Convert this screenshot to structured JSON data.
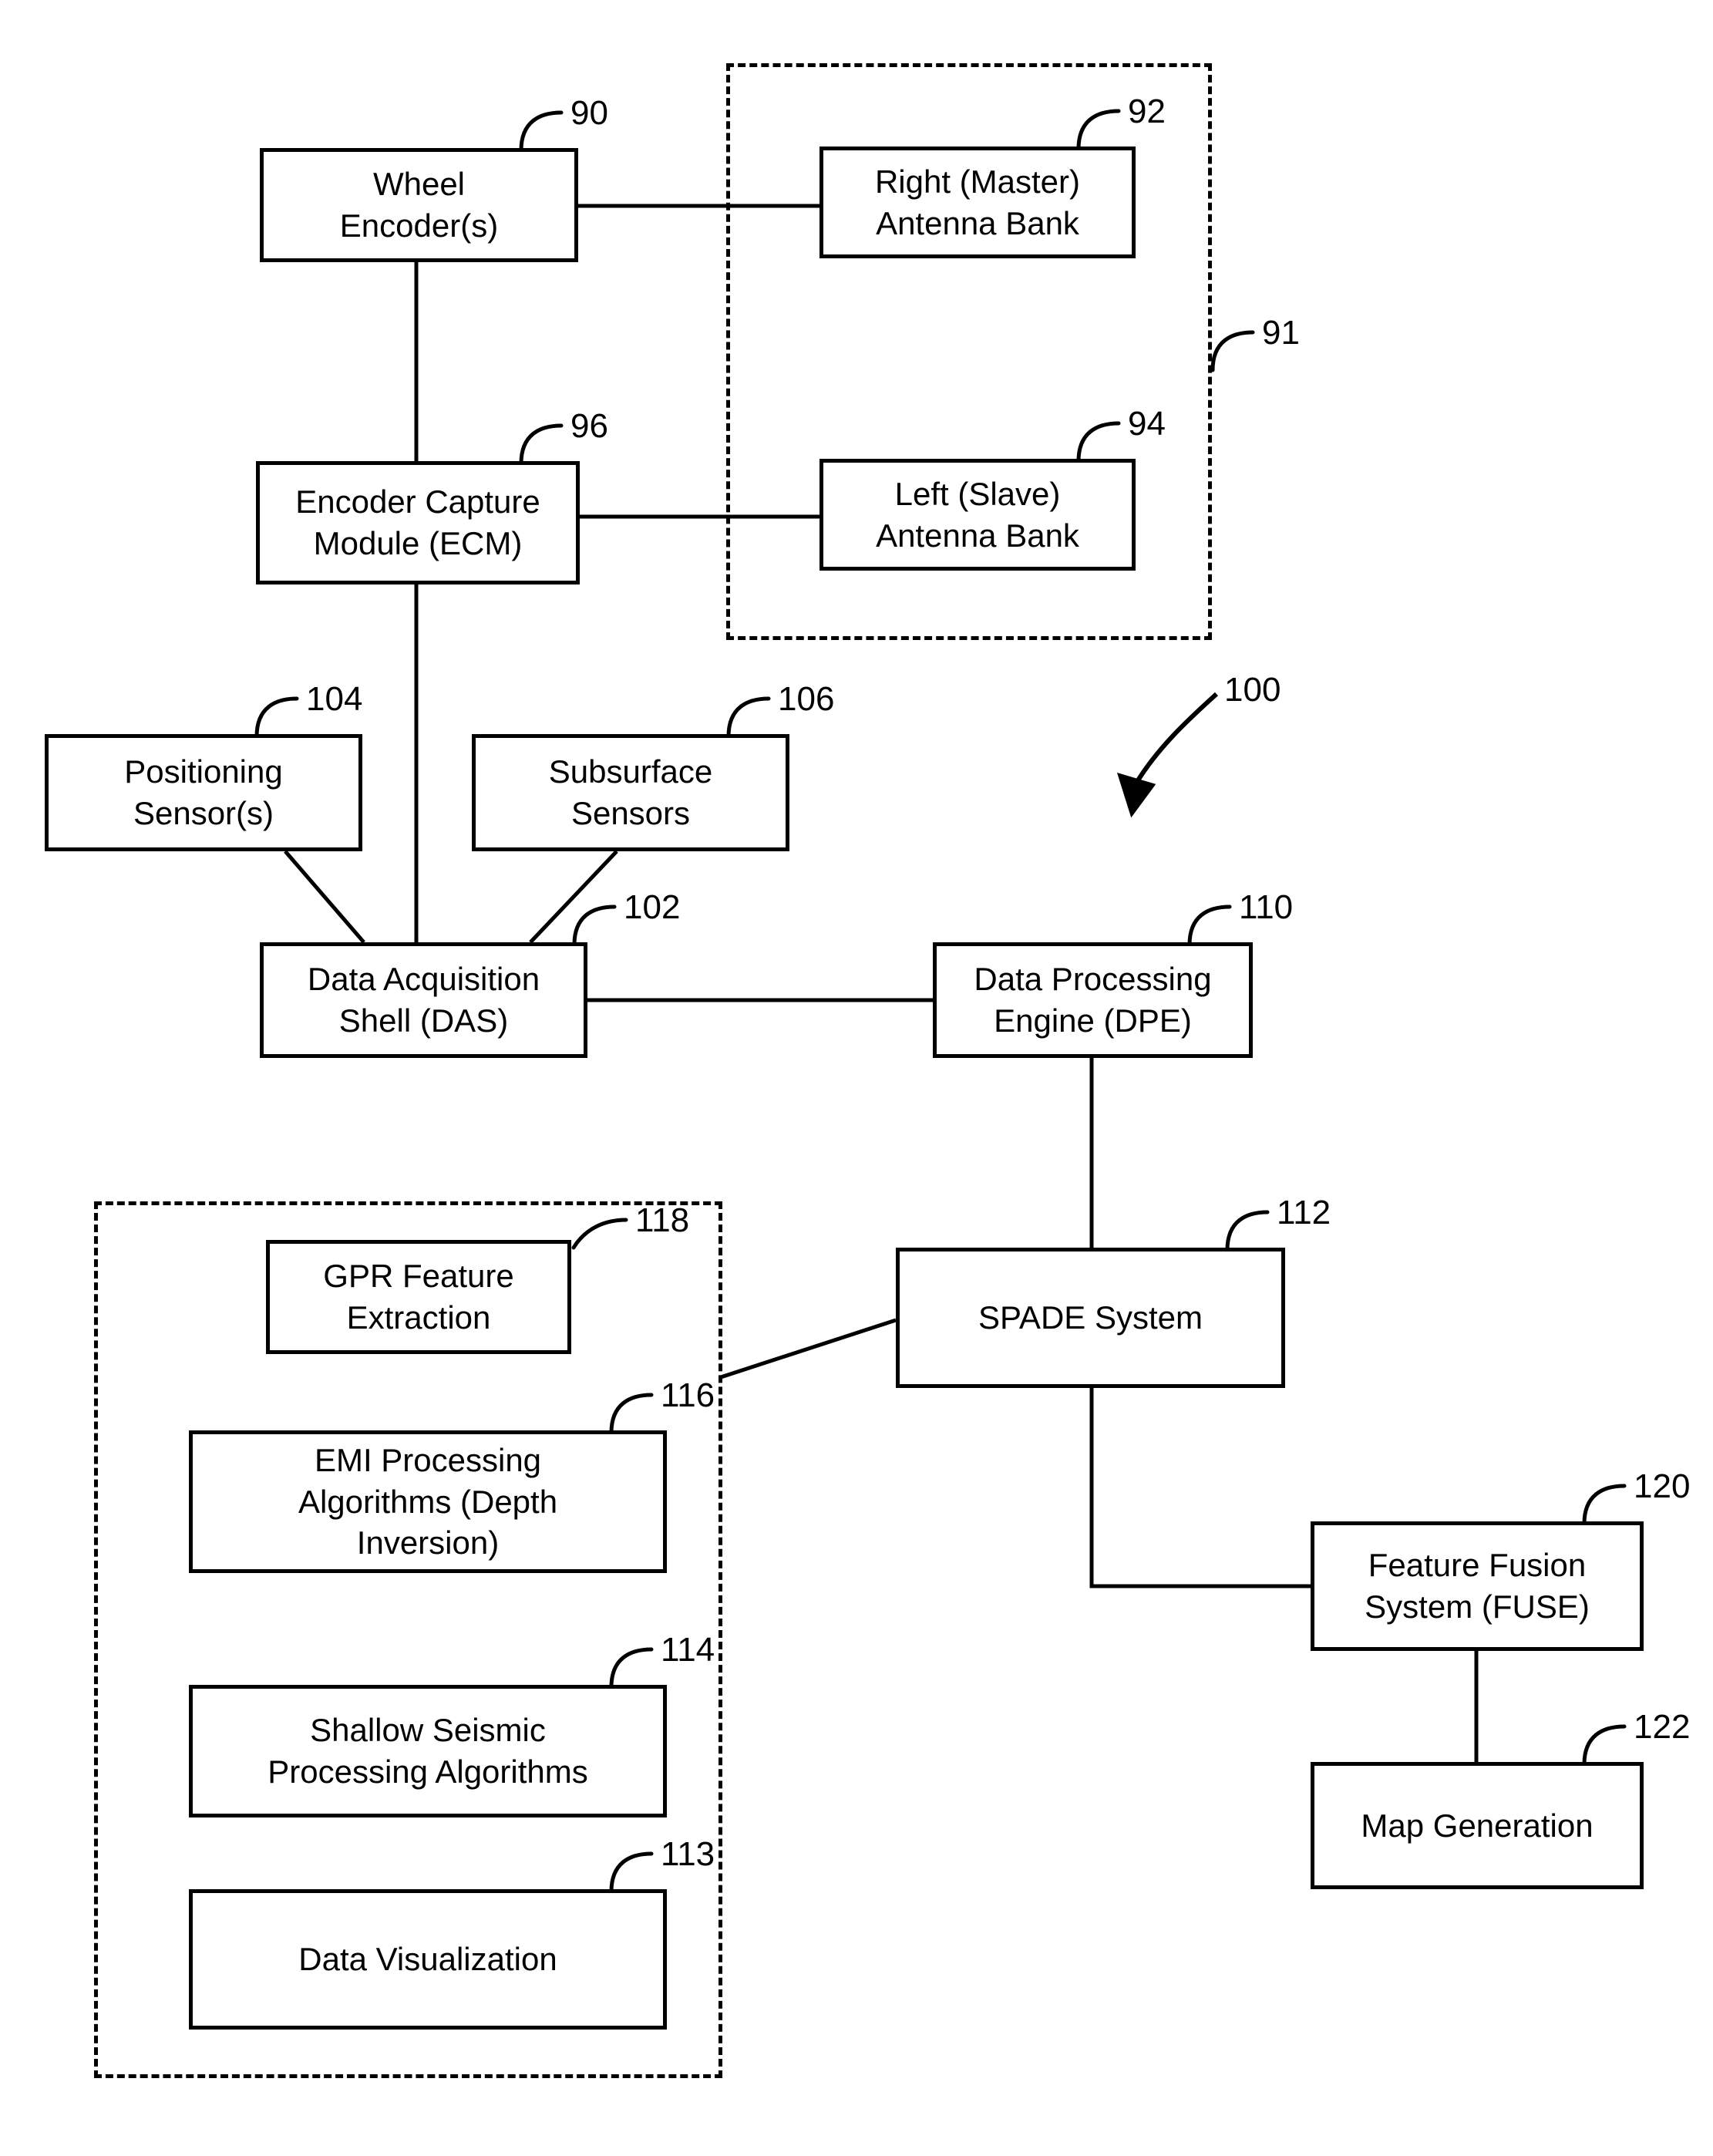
{
  "figure": {
    "type": "patent-block-diagram",
    "system_ref": "100",
    "background": "#ffffff",
    "line_color": "#000000"
  },
  "groups": [
    {
      "id": "antenna-group",
      "ref": "91",
      "style": "dashed"
    },
    {
      "id": "algorithms-group",
      "ref": "",
      "style": "dashed"
    }
  ],
  "nodes": {
    "wheel_encoder": {
      "line1": "Wheel",
      "line2": "Encoder(s)",
      "ref": "90"
    },
    "right_antenna_bank": {
      "line1": "Right (Master)",
      "line2": "Antenna Bank",
      "ref": "92"
    },
    "encoder_capture_module": {
      "line1": "Encoder Capture",
      "line2": "Module (ECM)",
      "ref": "96"
    },
    "left_antenna_bank": {
      "line1": "Left (Slave)",
      "line2": "Antenna Bank",
      "ref": "94"
    },
    "positioning_sensors": {
      "line1": "Positioning",
      "line2": "Sensor(s)",
      "ref": "104"
    },
    "subsurface_sensors": {
      "line1": "Subsurface",
      "line2": "Sensors",
      "ref": "106"
    },
    "data_acquisition_shell": {
      "line1": "Data Acquisition",
      "line2": "Shell (DAS)",
      "ref": "102"
    },
    "data_processing_engine": {
      "line1": "Data Processing",
      "line2": "Engine (DPE)",
      "ref": "110"
    },
    "spade_system": {
      "line1": "SPADE System",
      "line2": "",
      "ref": "112"
    },
    "gpr_feature_extraction": {
      "line1": "GPR Feature",
      "line2": "Extraction",
      "ref": "118"
    },
    "emi_processing": {
      "line1": "EMI Processing",
      "line2": "Algorithms (Depth",
      "line3": "Inversion)",
      "ref": "116"
    },
    "shallow_seismic": {
      "line1": "Shallow Seismic",
      "line2": "Processing Algorithms",
      "ref": "114"
    },
    "data_visualization": {
      "line1": "Data Visualization",
      "line2": "",
      "ref": "113"
    },
    "feature_fusion_system": {
      "line1": "Feature Fusion",
      "line2": "System (FUSE)",
      "ref": "120"
    },
    "map_generation": {
      "line1": "Map Generation",
      "line2": "",
      "ref": "122"
    }
  },
  "ref_labels": {
    "r90": "90",
    "r91": "91",
    "r92": "92",
    "r94": "94",
    "r96": "96",
    "r100": "100",
    "r102": "102",
    "r104": "104",
    "r106": "106",
    "r110": "110",
    "r112": "112",
    "r113": "113",
    "r114": "114",
    "r116": "116",
    "r118": "118",
    "r120": "120",
    "r122": "122"
  },
  "connections": [
    {
      "from": "wheel_encoder",
      "to": "right_antenna_bank"
    },
    {
      "from": "wheel_encoder",
      "to": "encoder_capture_module"
    },
    {
      "from": "encoder_capture_module",
      "to": "left_antenna_bank"
    },
    {
      "from": "encoder_capture_module",
      "to": "data_acquisition_shell"
    },
    {
      "from": "positioning_sensors",
      "to": "data_acquisition_shell"
    },
    {
      "from": "subsurface_sensors",
      "to": "data_acquisition_shell"
    },
    {
      "from": "data_acquisition_shell",
      "to": "data_processing_engine"
    },
    {
      "from": "data_processing_engine",
      "to": "spade_system"
    },
    {
      "from": "algorithms-group",
      "to": "spade_system"
    },
    {
      "from": "spade_system",
      "to": "feature_fusion_system"
    },
    {
      "from": "feature_fusion_system",
      "to": "map_generation"
    }
  ]
}
